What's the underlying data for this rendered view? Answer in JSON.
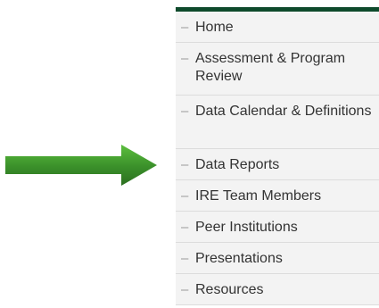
{
  "arrow": {
    "color": "#3a8f2a",
    "highlight": "#52b03a",
    "icon": "right-arrow-icon"
  },
  "sidebar": {
    "accent_color": "#0e4a2c",
    "dash_glyph": "–",
    "items": [
      {
        "label": "Home"
      },
      {
        "label": "Assessment & Program Review"
      },
      {
        "label": "Data Calendar & Definitions"
      },
      {
        "label": "Data Reports"
      },
      {
        "label": "IRE Team Members"
      },
      {
        "label": "Peer Institutions"
      },
      {
        "label": "Presentations"
      },
      {
        "label": "Resources"
      }
    ]
  }
}
